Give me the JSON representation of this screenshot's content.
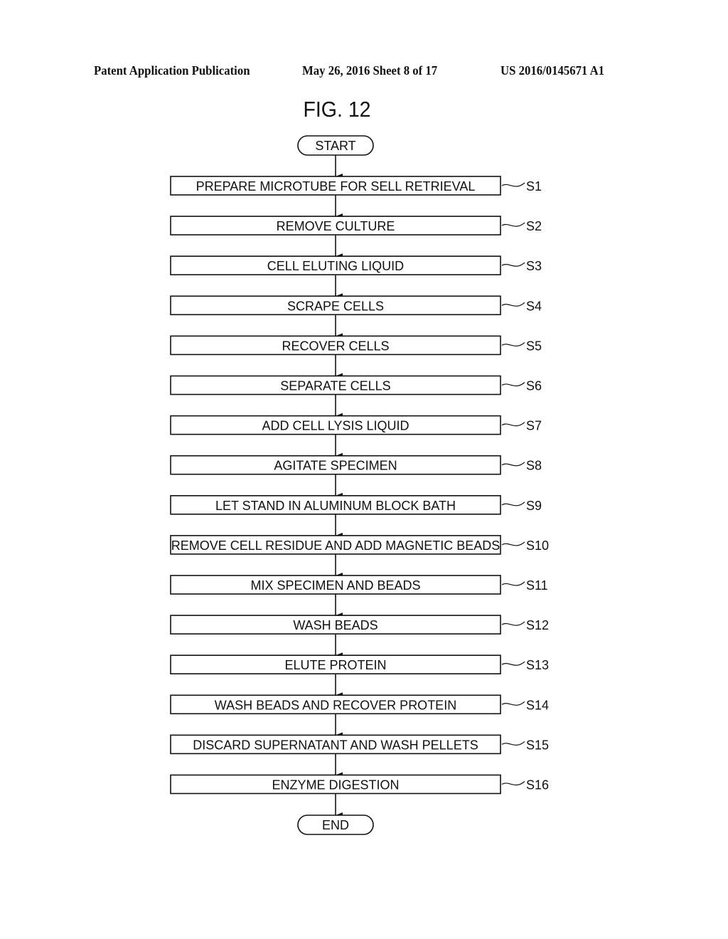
{
  "header": {
    "publication": "Patent Application Publication",
    "date_sheet": "May 26, 2016  Sheet 8 of 17",
    "patent_number": "US 2016/0145671 A1"
  },
  "figure": {
    "title": "FIG. 12",
    "start_label": "START",
    "end_label": "END",
    "steps": [
      {
        "id": "S1",
        "text": "PREPARE MICROTUBE FOR SELL RETRIEVAL"
      },
      {
        "id": "S2",
        "text": "REMOVE CULTURE"
      },
      {
        "id": "S3",
        "text": "CELL ELUTING LIQUID"
      },
      {
        "id": "S4",
        "text": "SCRAPE CELLS"
      },
      {
        "id": "S5",
        "text": "RECOVER CELLS"
      },
      {
        "id": "S6",
        "text": "SEPARATE CELLS"
      },
      {
        "id": "S7",
        "text": "ADD CELL LYSIS LIQUID"
      },
      {
        "id": "S8",
        "text": "AGITATE SPECIMEN"
      },
      {
        "id": "S9",
        "text": "LET STAND IN ALUMINUM BLOCK BATH"
      },
      {
        "id": "S10",
        "text": "REMOVE CELL RESIDUE AND ADD MAGNETIC BEADS"
      },
      {
        "id": "S11",
        "text": "MIX SPECIMEN AND BEADS"
      },
      {
        "id": "S12",
        "text": "WASH BEADS"
      },
      {
        "id": "S13",
        "text": "ELUTE PROTEIN"
      },
      {
        "id": "S14",
        "text": "WASH BEADS AND RECOVER PROTEIN"
      },
      {
        "id": "S15",
        "text": "DISCARD SUPERNATANT AND WASH PELLETS"
      },
      {
        "id": "S16",
        "text": "ENZYME DIGESTION"
      }
    ]
  }
}
